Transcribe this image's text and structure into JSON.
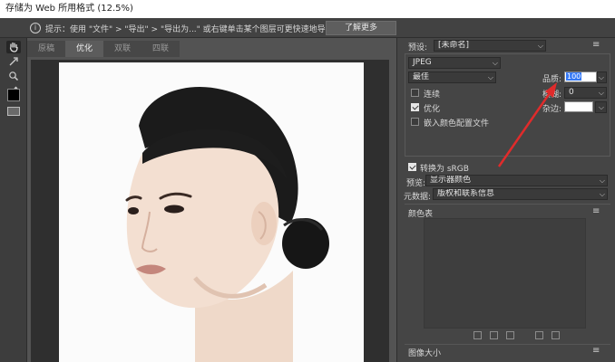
{
  "window": {
    "title": "存储为 Web 所用格式 (12.5%)"
  },
  "infobar": {
    "icon": "info-icon",
    "text": "提示：使用 \"文件\" > \"导出\" > \"导出为...\" 或右键单击某个图层可更快速地导出资源",
    "button_label": "了解更多"
  },
  "toolbox": {
    "tools": [
      "hand-icon",
      "slice-select-icon",
      "zoom-icon",
      "eyedropper-icon"
    ],
    "eyedropper_color": "#000000"
  },
  "canvas": {
    "tabs": [
      "原稿",
      "优化",
      "双联",
      "四联"
    ],
    "active_tab": "优化"
  },
  "settings": {
    "preset_label": "预设:",
    "preset_value": "[未命名]",
    "format_value": "JPEG",
    "quality_preset": "最佳",
    "quality_label": "品质:",
    "quality_value": "100",
    "blur_label": "模糊:",
    "blur_value": "0",
    "matte_label": "杂边:",
    "progressive_label": "连续",
    "progressive_checked": false,
    "optimized_label": "优化",
    "optimized_checked": true,
    "embed_profile_label": "嵌入颜色配置文件",
    "embed_profile_checked": false,
    "convert_srgb_label": "转换为 sRGB",
    "convert_srgb_checked": true,
    "preview_label": "预览:",
    "preview_value": "显示器颜色",
    "metadata_label": "元数据:",
    "metadata_value": "版权和联系信息",
    "color_table_label": "颜色表",
    "image_size_label": "图像大小"
  },
  "colors": {
    "arrow": "#e02b2b",
    "panel_bg": "#454545",
    "highlight": "#3478f6"
  }
}
